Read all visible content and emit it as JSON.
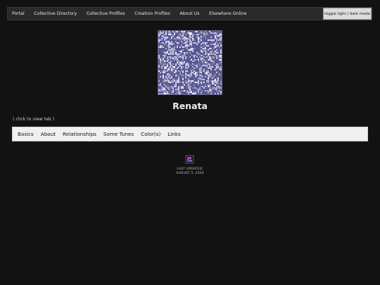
{
  "nav": {
    "items": [
      {
        "label": "Portal"
      },
      {
        "label": "Collective Directory"
      },
      {
        "label": "Collective Profiles"
      },
      {
        "label": "Creation Profiles"
      },
      {
        "label": "About Us"
      },
      {
        "label": "Elsewhere Online"
      }
    ],
    "toggle_label": "toggle light / dark mode"
  },
  "profile": {
    "name": "Renata",
    "avatar_icon": "static-noise-image",
    "tab_hint": "( click to view tab )"
  },
  "tabs": [
    {
      "label": "Basics"
    },
    {
      "label": "About"
    },
    {
      "label": "Relationships"
    },
    {
      "label": "Some Tunes"
    },
    {
      "label": "Color(s)"
    },
    {
      "label": "Links"
    }
  ],
  "footer": {
    "badge_icon": "pixel-badge-icon",
    "updated_label": "LAST UPDATED:",
    "updated_date": "AUGUST 5, 2024"
  },
  "colors": {
    "background": "#121212",
    "navbar": "#2a2a2a",
    "tabbar": "#f0f0f0",
    "noise_tint": "#8a86c8"
  }
}
